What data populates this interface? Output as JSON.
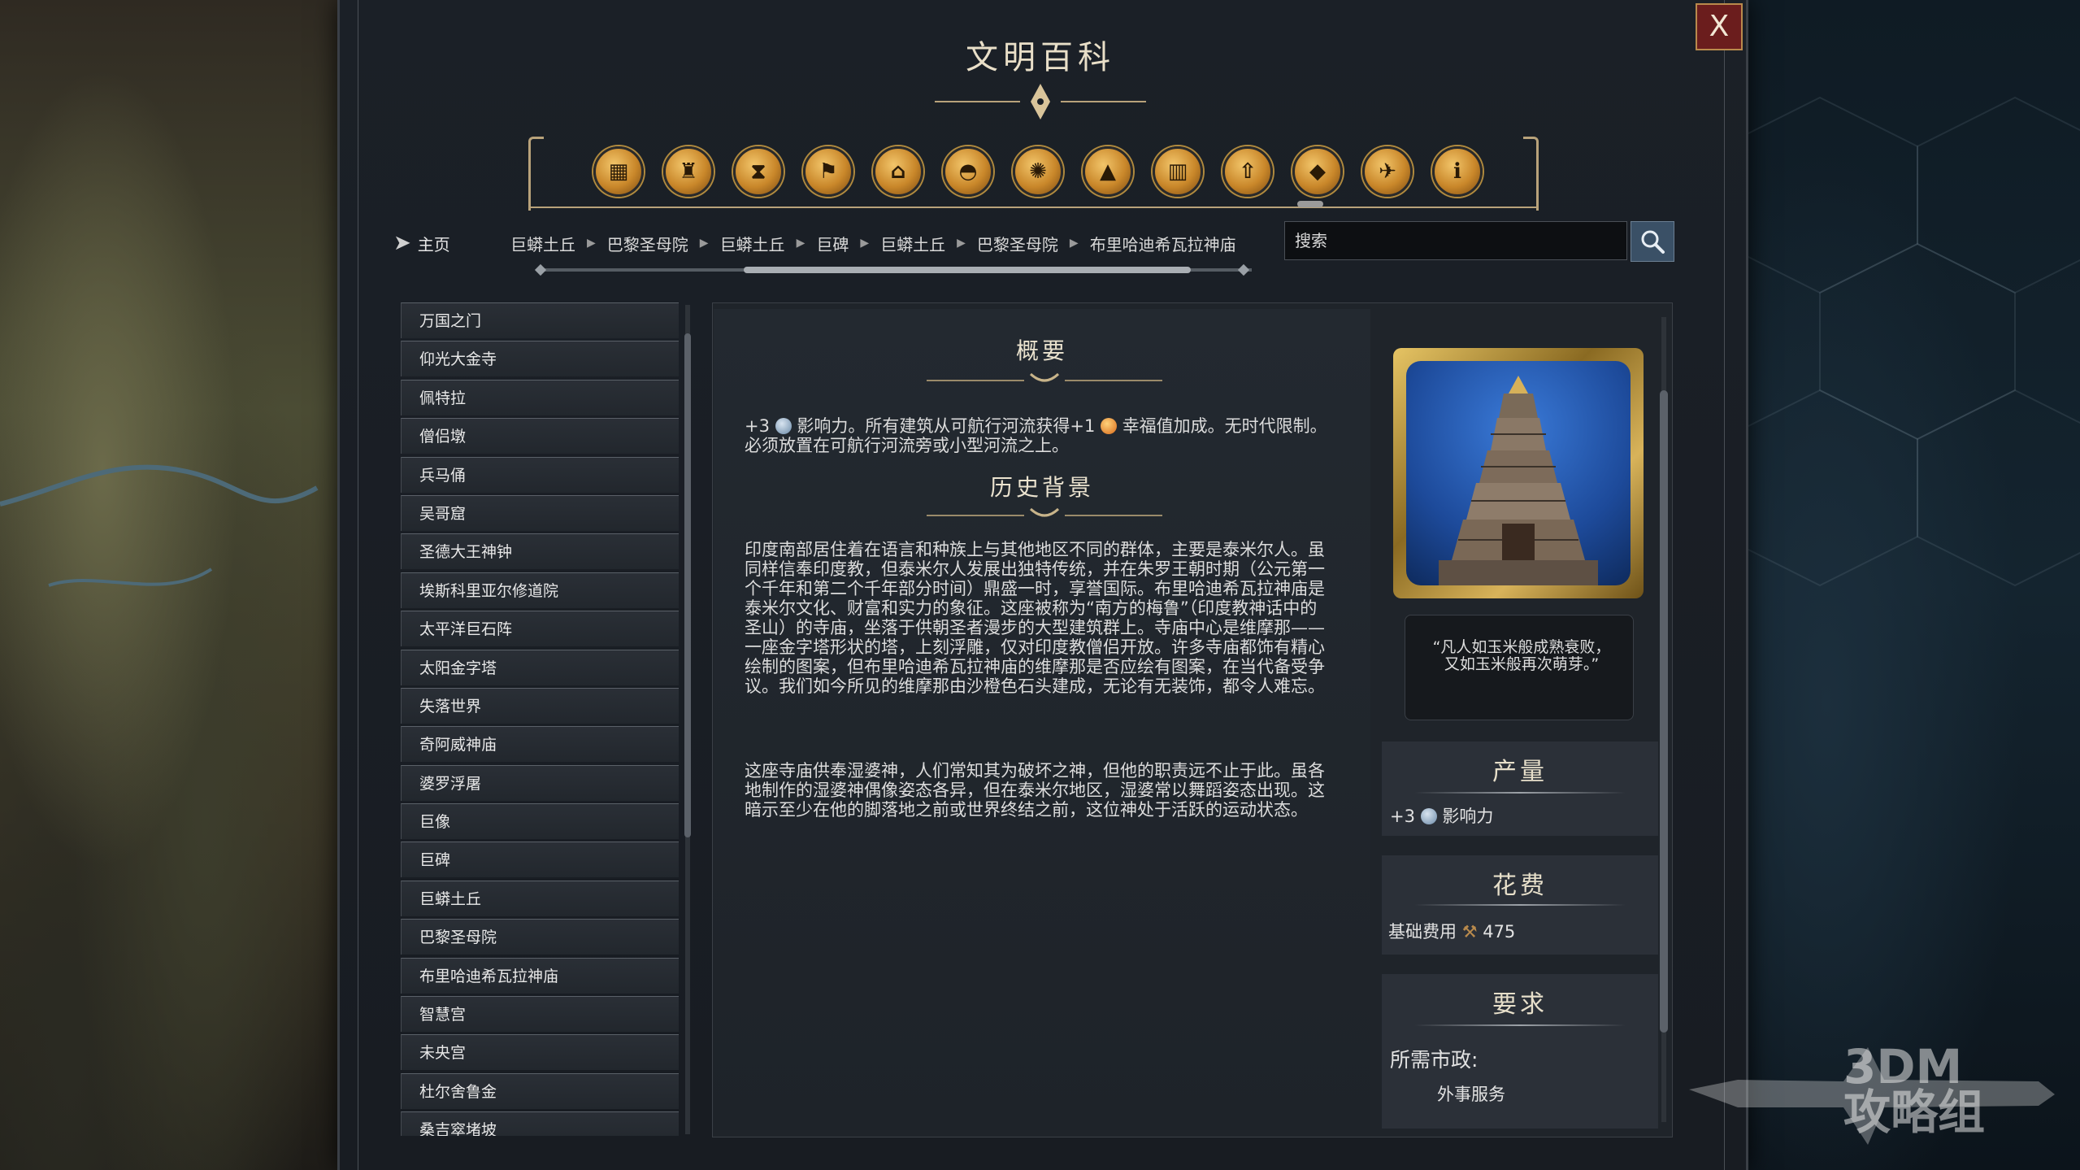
{
  "window": {
    "title": "文明百科",
    "close_label": "X"
  },
  "nav": {
    "categories": [
      {
        "icon": "crate-icon",
        "glyph": "▦"
      },
      {
        "icon": "chalice-icon",
        "glyph": "♜"
      },
      {
        "icon": "hourglass-icon",
        "glyph": "⧗"
      },
      {
        "icon": "flag-icon",
        "glyph": "⚑"
      },
      {
        "icon": "government-building-icon",
        "glyph": "⌂"
      },
      {
        "icon": "dome-icon",
        "glyph": "◓"
      },
      {
        "icon": "atom-icon",
        "glyph": "✺"
      },
      {
        "icon": "mountain-icon",
        "glyph": "▲"
      },
      {
        "icon": "city-icon",
        "glyph": "▥"
      },
      {
        "icon": "upgrade-arrow-icon",
        "glyph": "⇧"
      },
      {
        "icon": "great-works-icon",
        "glyph": "◆"
      },
      {
        "icon": "dove-icon",
        "glyph": "✈"
      },
      {
        "icon": "info-icon",
        "glyph": "ℹ"
      }
    ],
    "home_label": "主页",
    "breadcrumbs": [
      "巨蟒土丘",
      "巴黎圣母院",
      "巨蟒土丘",
      "巨碑",
      "巨蟒土丘",
      "巴黎圣母院",
      "布里哈迪希瓦拉神庙"
    ],
    "search": {
      "placeholder": "搜索"
    }
  },
  "sidebar": {
    "items": [
      "万国之门",
      "仰光大金寺",
      "佩特拉",
      "僧侣墩",
      "兵马俑",
      "吴哥窟",
      "圣德大王神钟",
      "埃斯科里亚尔修道院",
      "太平洋巨石阵",
      "太阳金字塔",
      "失落世界",
      "奇阿威神庙",
      "婆罗浮屠",
      "巨像",
      "巨碑",
      "巨蟒土丘",
      "巴黎圣母院",
      "布里哈迪希瓦拉神庙",
      "智慧宫",
      "未央宫",
      "杜尔舍鲁金",
      "桑吉窣堵坡"
    ]
  },
  "overview": {
    "title": "概要",
    "p_prefix": "+3",
    "p_part1": "影响力。所有建筑从可航行河流获得+1",
    "p_part2": "幸福值加成。无时代限制。必须放置在可航行河流旁或小型河流之上。"
  },
  "history": {
    "title": "历史背景",
    "p1": "印度南部居住着在语言和种族上与其他地区不同的群体，主要是泰米尔人。虽同样信奉印度教，但泰米尔人发展出独特传统，并在朱罗王朝时期（公元第一个千年和第二个千年部分时间）鼎盛一时，享誉国际。布里哈迪希瓦拉神庙是泰米尔文化、财富和实力的象征。这座被称为“南方的梅鲁”（印度教神话中的圣山）的寺庙，坐落于供朝圣者漫步的大型建筑群上。寺庙中心是维摩那——一座金字塔形状的塔，上刻浮雕，仅对印度教僧侣开放。许多寺庙都饰有精心绘制的图案，但布里哈迪希瓦拉神庙的维摩那是否应绘有图案，在当代备受争议。我们如今所见的维摩那由沙橙色石头建成，无论有无装饰，都令人难忘。",
    "p2": "这座寺庙供奉湿婆神，人们常知其为破坏之神，但他的职责远不止于此。虽各地制作的湿婆神偶像姿态各异，但在泰米尔地区，湿婆常以舞蹈姿态出现。这暗示至少在他的脚落地之前或世界终结之前，这位神处于活跃的运动状态。"
  },
  "details": {
    "quote": "“凡人如玉米般成熟衰败，又如玉米般再次萌芽。”",
    "production": {
      "title": "产量",
      "value": "+3",
      "label": "影响力"
    },
    "cost": {
      "title": "花费",
      "label": "基础费用",
      "value": "475"
    },
    "requirements": {
      "title": "要求",
      "label": "所需市政:",
      "value": "外事服务"
    }
  },
  "watermark": {
    "line1": "3DM",
    "line2": "攻略组"
  },
  "colors": {
    "accent_gold": "#b8a27a",
    "close_red": "#6b1d1d",
    "search_blue": "#3a5066"
  }
}
